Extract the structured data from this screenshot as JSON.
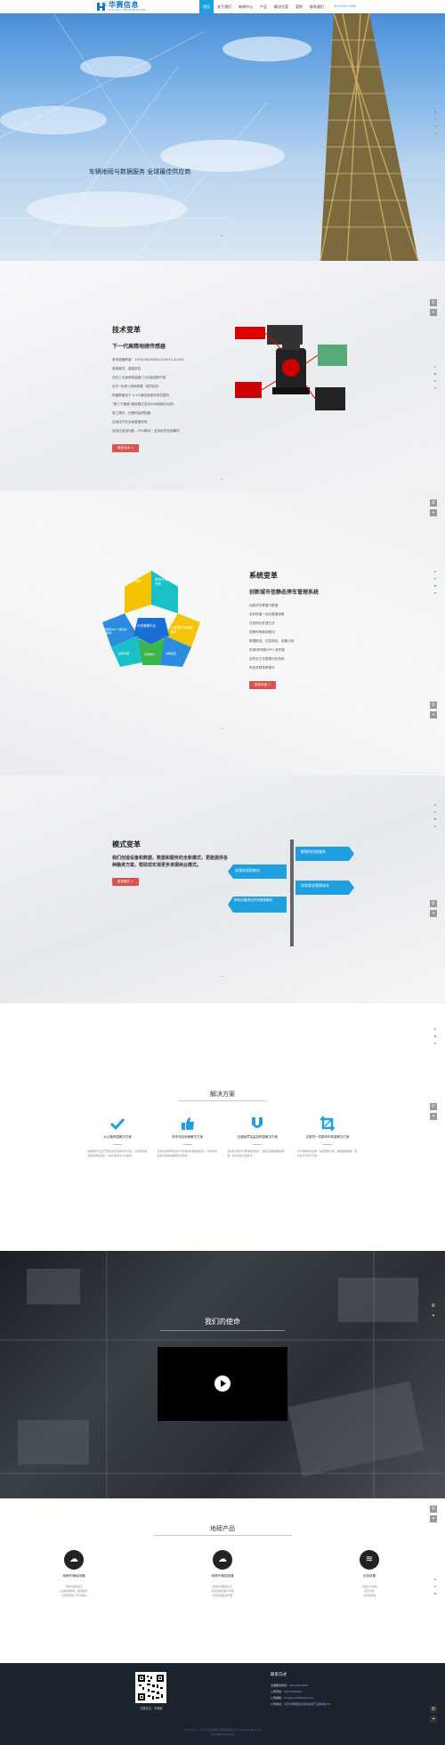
{
  "header": {
    "logo_cn": "华赛信息",
    "logo_en": "HUASAI INFORMATION",
    "nav": [
      "首页",
      "关于我们",
      "新闻中心",
      "产品",
      "解决方案",
      "案例",
      "联系我们"
    ],
    "hotline": "400-000-0000"
  },
  "hero": {
    "tagline": "车辆地磅与数据服务  全球最佳供应商"
  },
  "tech": {
    "title": "技术变革",
    "subtitle": "下一代高精地磅传感器",
    "features": [
      "单传感器称重：10/30/40/60/80/100t/12.4G/4G",
      "高速度性、高稳定性",
      "适应工业级使用温度/工地/高湿度环境",
      "实时 \"检测+按秤称重\" 或异检测",
      "称重精度优于 0.1%静态误差检测范围内",
      "\"第三方通道\"通信模式支持4G网络接口结构",
      "零工操作，无需改装称检器",
      "应用过开关多级数据标签",
      "适用过检测功能，CPU联动；支持优先检测模块"
    ],
    "more": "更多技术 >"
  },
  "system": {
    "title": "系统变革",
    "subtitle": "创新城市信静态停车管理系统",
    "features": [
      "远程开关称重与数据",
      "实时称重一站式数据采集",
      "在线预约处理方式",
      "查看车辆使用概况",
      "数据推送、应急响应、设备记录",
      "来源/秤场数APP+多终端",
      "实时全方位数据分析系统",
      "系统关联效率提升"
    ],
    "more": "更多系统 >",
    "diagram_labels": [
      "数字化运营计划 报表",
      "提供可视化数据分析",
      "中央管理平台",
      "管理员APP（多机通+多端）",
      "大数据平台数据统计",
      "指挥管理",
      "实现审计",
      "车辆监控"
    ]
  },
  "mode": {
    "title": "模式变革",
    "description": "我们创造设备和数据，数据和服务的全新模式，更能提供各种融资方案，帮助您实现更多资源商业模式。",
    "more": "更多模式 >",
    "ribbons": [
      "解锁供应链服务",
      "快速实现智能化",
      "实现收支管理成本",
      "帮你自建承包开放销售增收"
    ]
  },
  "solutions": {
    "title": "解决方案",
    "items": [
      {
        "name": "大公路称重解决方案",
        "desc": "车辆称重行业已开发的完善称重技术方案，可满足各类道路的称重需求，为用户提供全方位服务。"
      },
      {
        "name": "停车场及地磅解决方案",
        "desc": "采用先进的称重技术与停车场管理系统结合，为停车场提供高效的车辆称重与管理。"
      },
      {
        "name": "交通违章及监控称重解决方案",
        "desc": "通过实时监控与称重数据结合，快速识别超载超限车辆，提高道路交通安全。"
      },
      {
        "name": "北斯坦一览数率车称重解决方案",
        "desc": "针对特殊场景提供一站式称重方案，确保数据准确、服务及时与安全可靠。"
      }
    ]
  },
  "mission": {
    "title": "我们的使命"
  },
  "products": {
    "title": "地磅产品",
    "items": [
      {
        "name": "地磅车辆检测器",
        "features": [
          "零件检测免施工",
          "高速检测称重，精度超高",
          "无须开挖施工节约成本"
        ]
      },
      {
        "name": "地磅车辆控制器",
        "features": [
          "称重检测数据汇总",
          "实现远程控制与管理",
          "支持系统集成开发"
        ]
      },
      {
        "name": "无线设备",
        "features": [
          "无线信号传输",
          "稳定可靠",
          "支持多终端"
        ]
      }
    ]
  },
  "footer": {
    "qr_caption": "扫描关注：车管家",
    "contact_title": "联系方式",
    "rows": [
      {
        "label": "全国服务热线：",
        "value": "400-000-0000"
      },
      {
        "label": "公司传真：",
        "value": "020-3276009"
      },
      {
        "label": "公司邮箱：",
        "value": "huasai_info@163.com"
      },
      {
        "label": "公司地址：",
        "value": "北京市朝阳区某某科技园产业园8栋501"
      }
    ],
    "copyright": "Copyright © 2018 北京华赛信息科技有限公司 All Rights Reserved",
    "icp": "京ICP备00000000号"
  },
  "colors": {
    "accent": "#1e9fe0",
    "button": "#d9534f",
    "footer_bg": "#1a232e"
  }
}
